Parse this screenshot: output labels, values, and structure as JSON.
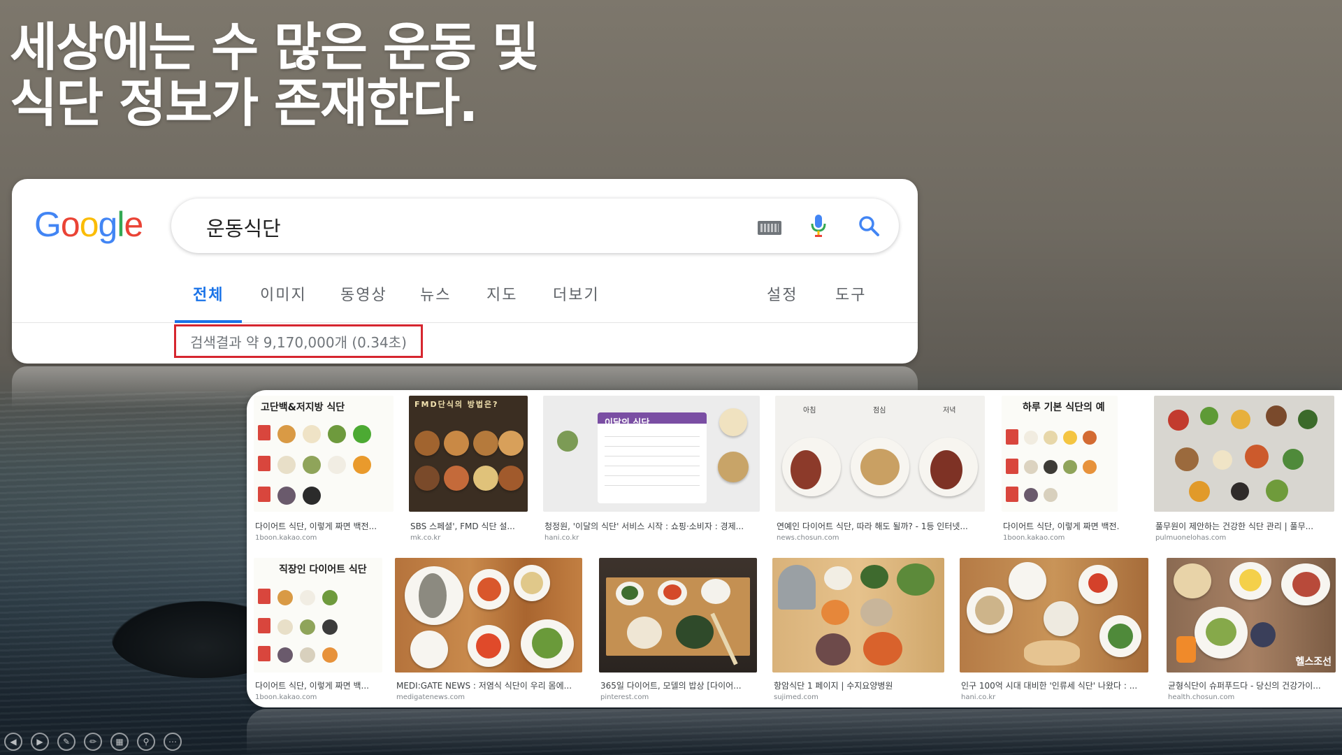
{
  "headline": {
    "line1": "세상에는 수 많은 운동 및",
    "line2": "식단 정보가 존재한다."
  },
  "google": {
    "logo_letters": [
      "G",
      "o",
      "o",
      "g",
      "l",
      "e"
    ],
    "search_query": "운동식단",
    "icons": {
      "keyboard": "keyboard-icon",
      "mic": "microphone-icon",
      "search": "search-icon"
    },
    "tabs": [
      {
        "label": "전체",
        "active": true
      },
      {
        "label": "이미지"
      },
      {
        "label": "동영상"
      },
      {
        "label": "뉴스"
      },
      {
        "label": "지도"
      },
      {
        "label": "더보기"
      },
      {
        "label": "설정"
      },
      {
        "label": "도구"
      }
    ],
    "result_count": "검색결과 약 9,170,000개 (0.34초)"
  },
  "images": {
    "row1": [
      {
        "title": "다이어트 식단, 이렇게 짜면 백전...",
        "source": "1boon.kakao.com",
        "thumb_text": "고단백&저지방 식단"
      },
      {
        "title": "SBS 스페셜', FMD 식단 설...",
        "source": "mk.co.kr",
        "thumb_text": "FMD단식의 방법은?"
      },
      {
        "title": "청정원, '이달의 식단' 서비스 시작 : 쇼핑·소비자 : 경제...",
        "source": "hani.co.kr",
        "thumb_text": "이달의 식단"
      },
      {
        "title": "연예인 다이어트 식단, 따라 해도 될까? - 1등 인터넷...",
        "source": "news.chosun.com",
        "thumb_text": [
          "아침",
          "점심",
          "저녁"
        ]
      },
      {
        "title": "다이어트 식단, 이렇게 짜면 백전...",
        "source": "1boon.kakao.com",
        "thumb_text": "하루 기본 식단의 예"
      },
      {
        "title": "풀무원이 제안하는 건강한 식단 관리 | 풀무...",
        "source": "pulmuonelohas.com"
      }
    ],
    "row2": [
      {
        "title": "다이어트 식단, 이렇게 짜면 백...",
        "source": "1boon.kakao.com",
        "thumb_text": "직장인 다이어트 식단"
      },
      {
        "title": "MEDI:GATE NEWS : 저염식 식단이 우리 몸에...",
        "source": "medigatenews.com"
      },
      {
        "title": "365일 다이어트, 모델의 밥상 [다이어...",
        "source": "pinterest.com"
      },
      {
        "title": "항암식단 1 페이지 | 수지요양병원",
        "source": "sujimed.com"
      },
      {
        "title": "인구 100억 시대 대비한 '인류세 식단' 나왔다 : ...",
        "source": "hani.co.kr"
      },
      {
        "title": "균형식단이 슈퍼푸드다 - 당신의 건강가이...",
        "source": "health.chosun.com",
        "thumb_text": "헬스조선"
      }
    ]
  },
  "slideshow_controls": [
    "prev-icon",
    "next-icon",
    "pen-icon",
    "edit-icon",
    "slides-icon",
    "zoom-icon",
    "more-icon"
  ]
}
